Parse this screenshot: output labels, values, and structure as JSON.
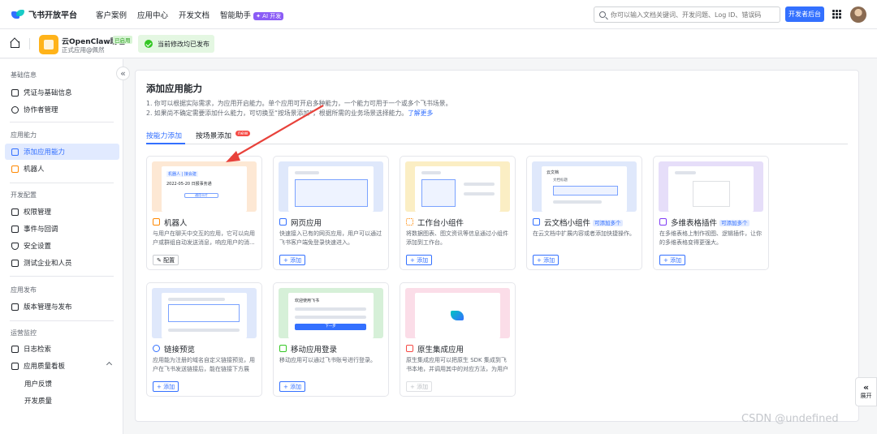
{
  "topbar": {
    "logo_text": "飞书开放平台",
    "nav": [
      "客户案例",
      "应用中心",
      "开发文档",
      "智能助手"
    ],
    "ai_badge": "✦ AI 开发",
    "search_placeholder": "你可以输入文档关键词、开发问题、Log ID、错误码",
    "console_button": "开发者后台"
  },
  "app": {
    "name": "云OpenClaw助理",
    "status": "已启用",
    "owner": "正式应用@佩然",
    "publish_status": "当前修改均已发布"
  },
  "sidebar": {
    "collapse": "«",
    "groups": [
      {
        "label": "基础信息",
        "items": [
          "凭证与基础信息",
          "协作者管理"
        ]
      },
      {
        "label": "应用能力",
        "items": [
          "添加应用能力",
          "机器人"
        ]
      },
      {
        "label": "开发配置",
        "items": [
          "权限管理",
          "事件与回调",
          "安全设置",
          "测试企业和人员"
        ]
      },
      {
        "label": "应用发布",
        "items": [
          "版本管理与发布"
        ]
      },
      {
        "label": "运营监控",
        "items": [
          "日志检索",
          "应用质量看板",
          "用户反馈",
          "开发质量"
        ]
      }
    ]
  },
  "main": {
    "title": "添加应用能力",
    "desc1": "1. 你可以根据实际需求，为应用开启能力。单个应用可开启多种能力，一个能力可用于一个或多个飞书场景。",
    "desc2": "2. 如果尚不确定需要添加什么能力，可切换至“按场景添加”，根据所需的业务场景选择能力。",
    "learn_more": "了解更多",
    "tabs": [
      "按能力添加",
      "按场景添加"
    ],
    "new_badge": "new",
    "cards": [
      {
        "title": "机器人",
        "tag": "",
        "desc": "与用户在聊天中交互的应用，它可以向用户或群组自动发送消息，响应用户的消...",
        "button": "✎ 配置"
      },
      {
        "title": "网页应用",
        "tag": "",
        "desc": "快速接入已有的网页应用，用户可以通过飞书客户端免登录快速进入。",
        "button": "+ 添加"
      },
      {
        "title": "工作台小组件",
        "tag": "",
        "desc": "将数据图表、图文资讯等信息通过小组件添加到工作台。",
        "button": "+ 添加"
      },
      {
        "title": "云文档小组件",
        "tag": "可添加多个",
        "desc": "在云文档中扩展内容或者添加快捷操作。",
        "button": "+ 添加"
      },
      {
        "title": "多维表格插件",
        "tag": "可添加多个",
        "desc": "在多维表格上制作视图、逻辑插件，让你的多维表格变得更强大。",
        "button": "+ 添加"
      },
      {
        "title": "链接预览",
        "tag": "",
        "desc": "应用能为注册的域名自定义链接预览，用户在飞书发送链接后，能在链接下方展示...",
        "button": "+ 添加"
      },
      {
        "title": "移动应用登录",
        "tag": "",
        "desc": "移动应用可以通过飞书账号进行登录。",
        "button": "+ 添加"
      },
      {
        "title": "原生集成应用",
        "tag": "",
        "desc": "原生集成应用可以把原生 SDK 集成到飞书本地，并调用其中的对应方法，为用户提...",
        "button": "+ 添加"
      }
    ],
    "thumb": {
      "bot_chip": "机器人 | 接会建",
      "bot_date": "2022-05-20 日报事务通",
      "bot_btn": "通用卡片",
      "mobile_heading": "欢迎使用飞书",
      "mobile_btn": "下一步",
      "doc_label": "云文档",
      "doc_sub": "文档标题"
    }
  },
  "float_button": {
    "arrows": "«",
    "label": "展开"
  },
  "watermark": "CSDN @undefined",
  "colors": {
    "accent": "#3370ff",
    "arrow": "#e8423b"
  }
}
